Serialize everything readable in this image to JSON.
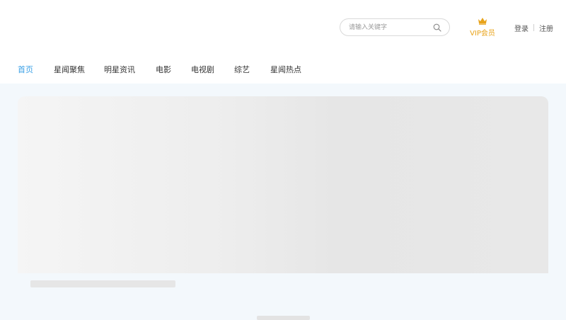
{
  "search": {
    "placeholder": "请输入关键字",
    "icon": "search-icon"
  },
  "vip": {
    "label": "VIP会员",
    "icon": "crown-icon",
    "color": "#e8a31a"
  },
  "auth": {
    "login": "登录",
    "register": "注册"
  },
  "nav": {
    "items": [
      {
        "label": "首页",
        "active": true
      },
      {
        "label": "星闻聚焦",
        "active": false
      },
      {
        "label": "明星资讯",
        "active": false
      },
      {
        "label": "电影",
        "active": false
      },
      {
        "label": "电视剧",
        "active": false
      },
      {
        "label": "综艺",
        "active": false
      },
      {
        "label": "星闻热点",
        "active": false
      }
    ]
  },
  "colors": {
    "accent": "#3aa0e6",
    "page_bg": "#f3f8fc"
  }
}
